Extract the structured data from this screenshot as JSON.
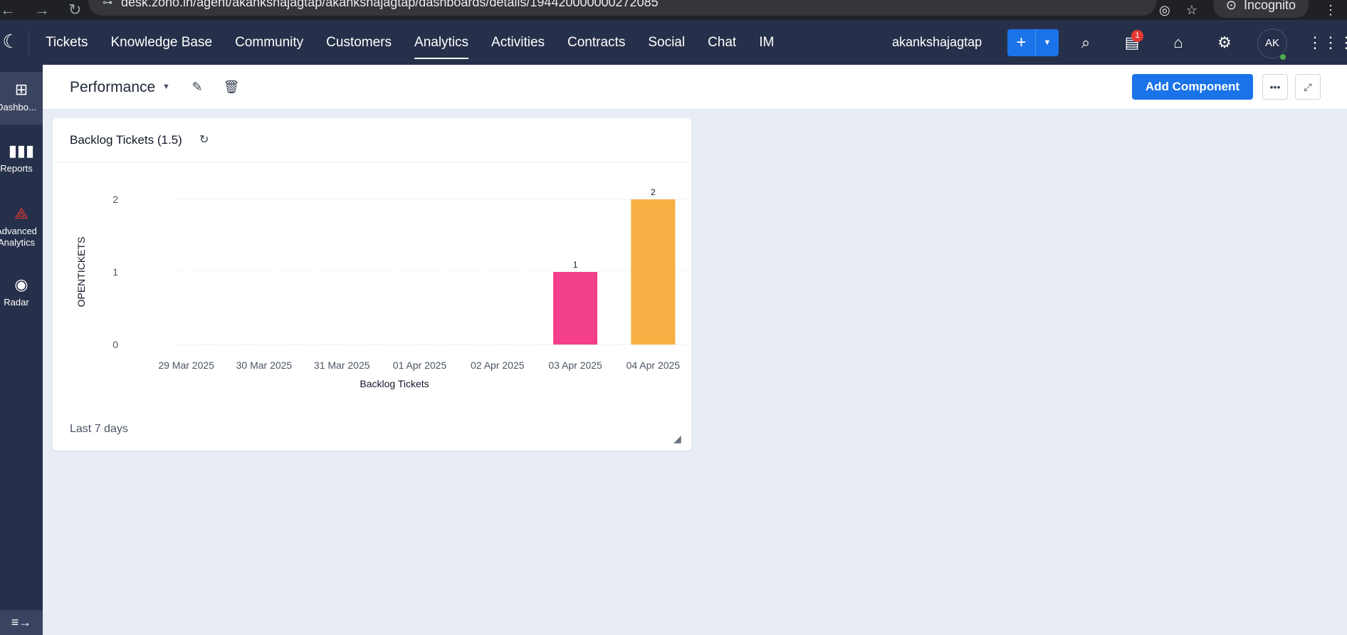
{
  "browser": {
    "url": "desk.zoho.in/agent/akankshajagtap/akankshajagtap/dashboards/details/194420000000272085",
    "incognito_label": "Incognito"
  },
  "topnav": {
    "tabs": [
      {
        "label": "Tickets"
      },
      {
        "label": "Knowledge Base"
      },
      {
        "label": "Community"
      },
      {
        "label": "Customers"
      },
      {
        "label": "Analytics",
        "active": true
      },
      {
        "label": "Activities"
      },
      {
        "label": "Contracts"
      },
      {
        "label": "Social"
      },
      {
        "label": "Chat"
      },
      {
        "label": "IM"
      }
    ],
    "user_name": "akankshajagtap",
    "notification_count": "1",
    "avatar_initials": "AK"
  },
  "sidebar": {
    "items": [
      {
        "label": "Dashbo...",
        "icon": "dashboard-icon",
        "active": true
      },
      {
        "label": "Reports",
        "icon": "bar-chart-icon"
      },
      {
        "label": "Advanced Analytics",
        "icon": "analytics-icon"
      },
      {
        "label": "Radar",
        "icon": "radar-icon"
      }
    ]
  },
  "header": {
    "title": "Performance",
    "add_component_label": "Add Component"
  },
  "widget": {
    "title": "Backlog Tickets (1.5)",
    "footer": "Last 7 days"
  },
  "chart_data": {
    "type": "bar",
    "categories": [
      "29 Mar 2025",
      "30 Mar 2025",
      "31 Mar 2025",
      "01 Apr 2025",
      "02 Apr 2025",
      "03 Apr 2025",
      "04 Apr 2025"
    ],
    "values": [
      0,
      0,
      0,
      0,
      0,
      1,
      2
    ],
    "colors": [
      "#f43f8a",
      "#f43f8a",
      "#f43f8a",
      "#f43f8a",
      "#f43f8a",
      "#f43f8a",
      "#f7b044"
    ],
    "xlabel": "Backlog Tickets",
    "ylabel": "OPENTICKETS",
    "yticks": [
      0,
      1,
      2
    ],
    "ylim": [
      0,
      2
    ],
    "grid": true,
    "show_data_labels": true
  }
}
